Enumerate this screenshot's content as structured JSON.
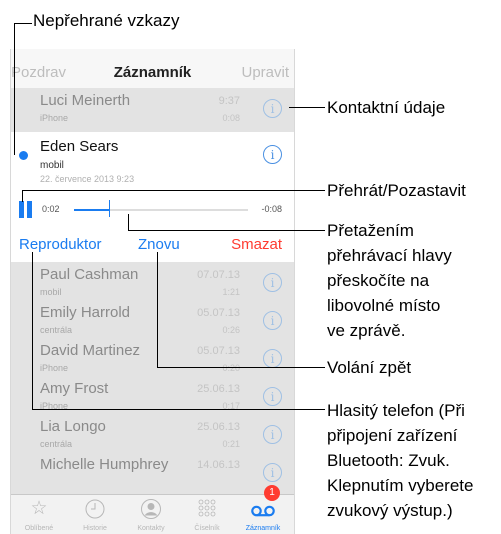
{
  "annotations": {
    "unread": "Nepřehrané vzkazy",
    "contact": "Kontaktní údaje",
    "playpause": "Přehrát/Pozastavit",
    "scrub": [
      "Přetažením",
      "přehrávací hlavy",
      "přeskočíte na",
      "libovolné místo",
      "ve zprávě."
    ],
    "callback": "Volání zpět",
    "speaker": [
      "Hlasitý telefon (Při",
      "připojení zařízení",
      "Bluetooth: Zvuk.",
      "Klepnutím vyberete",
      "zvukový výstup.)"
    ]
  },
  "navbar": {
    "left": "Pozdrav",
    "title": "Záznamník",
    "right": "Upravit"
  },
  "rows_top": [
    {
      "name": "Luci Meinerth",
      "sub": "iPhone",
      "date": "9:37",
      "dur": "0:08"
    }
  ],
  "expanded": {
    "name": "Eden Sears",
    "sub": "mobil",
    "date": "22. července 2013 9:23",
    "time_start": "0:02",
    "time_end": "-0:08",
    "progress": 0.2,
    "speaker": "Reproduktor",
    "call_back": "Znovu",
    "delete": "Smazat"
  },
  "rows": [
    {
      "name": "Paul Cashman",
      "sub": "mobil",
      "date": "07.07.13",
      "dur": "1:21"
    },
    {
      "name": "Emily Harrold",
      "sub": "centrála",
      "date": "05.07.13",
      "dur": "0:26"
    },
    {
      "name": "David Martinez",
      "sub": "iPhone",
      "date": "05.07.13",
      "dur": "0:20"
    },
    {
      "name": "Amy Frost",
      "sub": "iPhone",
      "date": "25.06.13",
      "dur": "0:17"
    },
    {
      "name": "Lia Longo",
      "sub": "centrála",
      "date": "25.06.13",
      "dur": "0:21"
    },
    {
      "name": "Michelle Humphrey",
      "sub": "",
      "date": "14.06.13",
      "dur": ""
    }
  ],
  "tabbar": {
    "tabs": [
      {
        "label": "Oblíbené",
        "icon": "star-icon"
      },
      {
        "label": "Historie",
        "icon": "clock-icon"
      },
      {
        "label": "Kontakty",
        "icon": "person-icon"
      },
      {
        "label": "Číselník",
        "icon": "keypad-icon"
      },
      {
        "label": "Záznamník",
        "icon": "voicemail-icon"
      }
    ],
    "badge": "1"
  },
  "colors": {
    "accent": "#1a7cf0",
    "destructive": "#ff3b30"
  }
}
